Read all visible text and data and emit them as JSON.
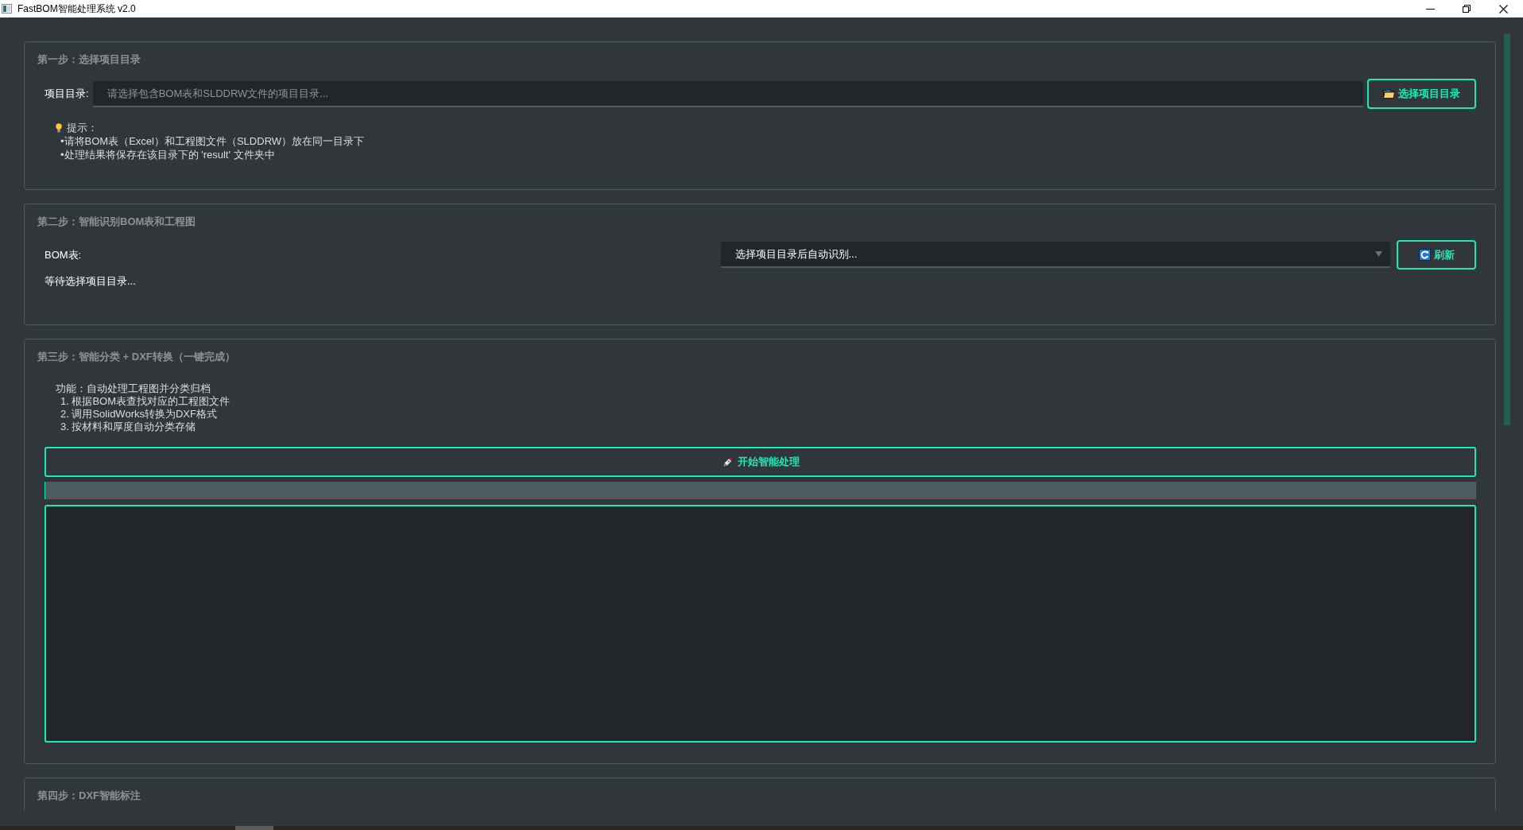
{
  "window": {
    "title": "FastBOM智能处理系统 v2.0"
  },
  "steps": [
    {
      "kind": "directory",
      "title": "第一步：选择项目目录",
      "field_label": "项目目录:",
      "field": {
        "placeholder": "请选择包含BOM表和SLDDRW文件的项目目录..."
      },
      "button": {
        "label": "选择项目目录"
      },
      "tip": {
        "heading": "提示：",
        "lines": [
          "•请将BOM表（Excel）和工程图文件（SLDDRW）放在同一目录下",
          "•处理结果将保存在该目录下的 'result' 文件夹中"
        ]
      }
    },
    {
      "kind": "recognition",
      "title": "第二步：智能识别BOM表和工程图",
      "field_label": "BOM表:",
      "dropdown": {
        "value": "选择项目目录后自动识别..."
      },
      "button": {
        "label": "刷新"
      },
      "status": "等待选择项目目录..."
    },
    {
      "kind": "processing",
      "title": "第三步：智能分类 + DXF转换（一键完成）",
      "description": {
        "heading": "功能：自动处理工程图并分类归档",
        "items": [
          "1. 根据BOM表查找对应的工程图文件",
          "2. 调用SolidWorks转换为DXF格式",
          "3. 按材料和厚度自动分类存储"
        ]
      },
      "button": {
        "label": "开始智能处理"
      },
      "progress": {
        "level": 0
      }
    },
    {
      "kind": "annotation",
      "title": "第四步：DXF智能标注"
    }
  ]
}
